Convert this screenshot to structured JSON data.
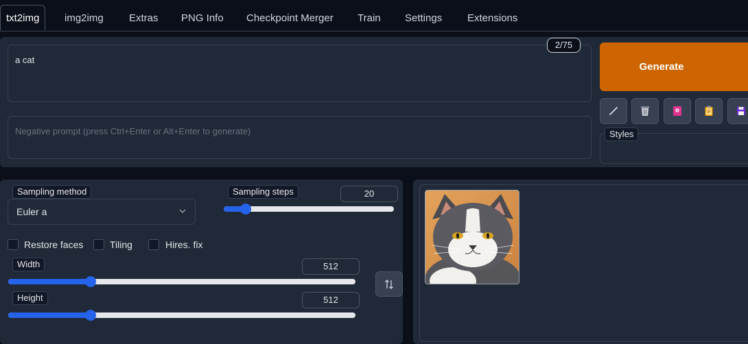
{
  "tabs": [
    {
      "label": "txt2img",
      "active": true
    },
    {
      "label": "img2img"
    },
    {
      "label": "Extras"
    },
    {
      "label": "PNG Info"
    },
    {
      "label": "Checkpoint Merger"
    },
    {
      "label": "Train"
    },
    {
      "label": "Settings"
    },
    {
      "label": "Extensions"
    }
  ],
  "prompt": {
    "value": "a cat",
    "token_count": "2/75",
    "negative_placeholder": "Negative prompt (press Ctrl+Enter or Alt+Enter to generate)"
  },
  "actions": {
    "generate_label": "Generate",
    "tools": [
      "pencil-icon",
      "trash-icon",
      "card-icon",
      "clipboard-icon",
      "save-icon"
    ]
  },
  "styles": {
    "label": "Styles"
  },
  "settings": {
    "sampling_method": {
      "label": "Sampling method",
      "value": "Euler a"
    },
    "sampling_steps": {
      "label": "Sampling steps",
      "value": "20",
      "fraction": 0.13
    },
    "checkboxes": [
      {
        "label": "Restore faces",
        "checked": false
      },
      {
        "label": "Tiling",
        "checked": false
      },
      {
        "label": "Hires. fix",
        "checked": false
      }
    ],
    "width": {
      "label": "Width",
      "value": "512",
      "fraction": 0.237
    },
    "height": {
      "label": "Height",
      "value": "512",
      "fraction": 0.237
    },
    "swap_icon": "swap-vertical-icon"
  },
  "colors": {
    "generate": "#cc6400",
    "accent": "#2563eb",
    "panel": "#1f2937",
    "background": "#0b0f19"
  }
}
